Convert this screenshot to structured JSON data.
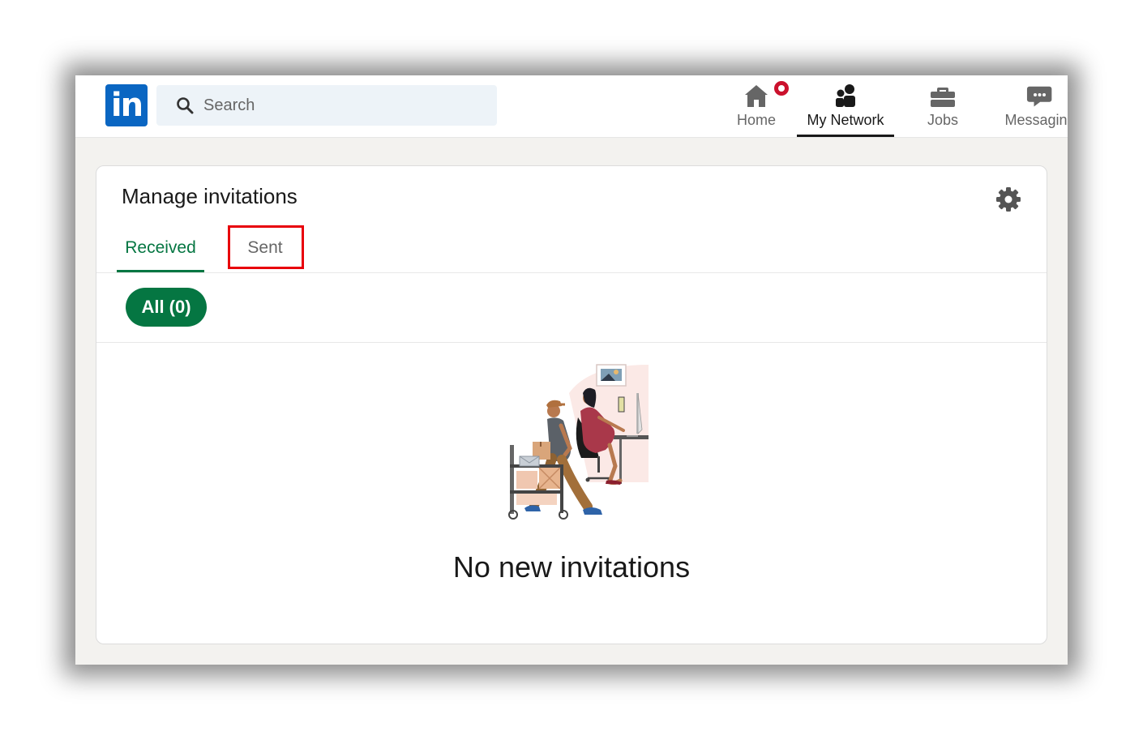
{
  "brand": {
    "logo_text": "in",
    "color": "#0a66c2"
  },
  "search": {
    "placeholder": "Search",
    "value": ""
  },
  "nav": {
    "items": [
      {
        "label": "Home",
        "icon": "home-icon",
        "has_badge": true
      },
      {
        "label": "My Network",
        "icon": "network-icon",
        "active": true
      },
      {
        "label": "Jobs",
        "icon": "briefcase-icon"
      },
      {
        "label": "Messaging",
        "icon": "messaging-icon"
      }
    ]
  },
  "card": {
    "title": "Manage invitations",
    "tabs": [
      {
        "label": "Received",
        "active": true
      },
      {
        "label": "Sent",
        "active": false
      }
    ],
    "filter": {
      "label": "All (0)"
    },
    "empty_state": {
      "message": "No new invitations",
      "illustration": "people-working-illustration"
    }
  },
  "colors": {
    "accent_green": "#057642",
    "highlight_red": "#e8000b",
    "notification_red": "#cb112d",
    "background": "#f3f2ef"
  }
}
